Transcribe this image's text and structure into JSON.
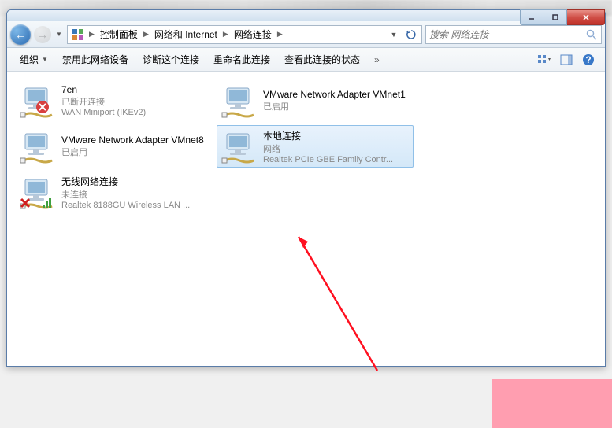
{
  "breadcrumbs": [
    "控制面板",
    "网络和 Internet",
    "网络连接"
  ],
  "search": {
    "placeholder": "搜索 网络连接"
  },
  "toolbar": {
    "organize": "组织",
    "disable": "禁用此网络设备",
    "diagnose": "诊断这个连接",
    "rename": "重命名此连接",
    "viewstatus": "查看此连接的状态"
  },
  "connections": [
    {
      "name": "7en",
      "status": "已断开连接",
      "device": "WAN Miniport (IKEv2)",
      "selected": false,
      "badge": "disconnected"
    },
    {
      "name": "VMware Network Adapter VMnet1",
      "status": "已启用",
      "device": "",
      "selected": false,
      "badge": "none"
    },
    {
      "name": "VMware Network Adapter VMnet8",
      "status": "已启用",
      "device": "",
      "selected": false,
      "badge": "none"
    },
    {
      "name": "本地连接",
      "status": "网络",
      "device": "Realtek PCIe GBE Family Contr...",
      "selected": true,
      "badge": "none"
    },
    {
      "name": "无线网络连接",
      "status": "未连接",
      "device": "Realtek 8188GU Wireless LAN ...",
      "selected": false,
      "badge": "error-signal"
    }
  ]
}
